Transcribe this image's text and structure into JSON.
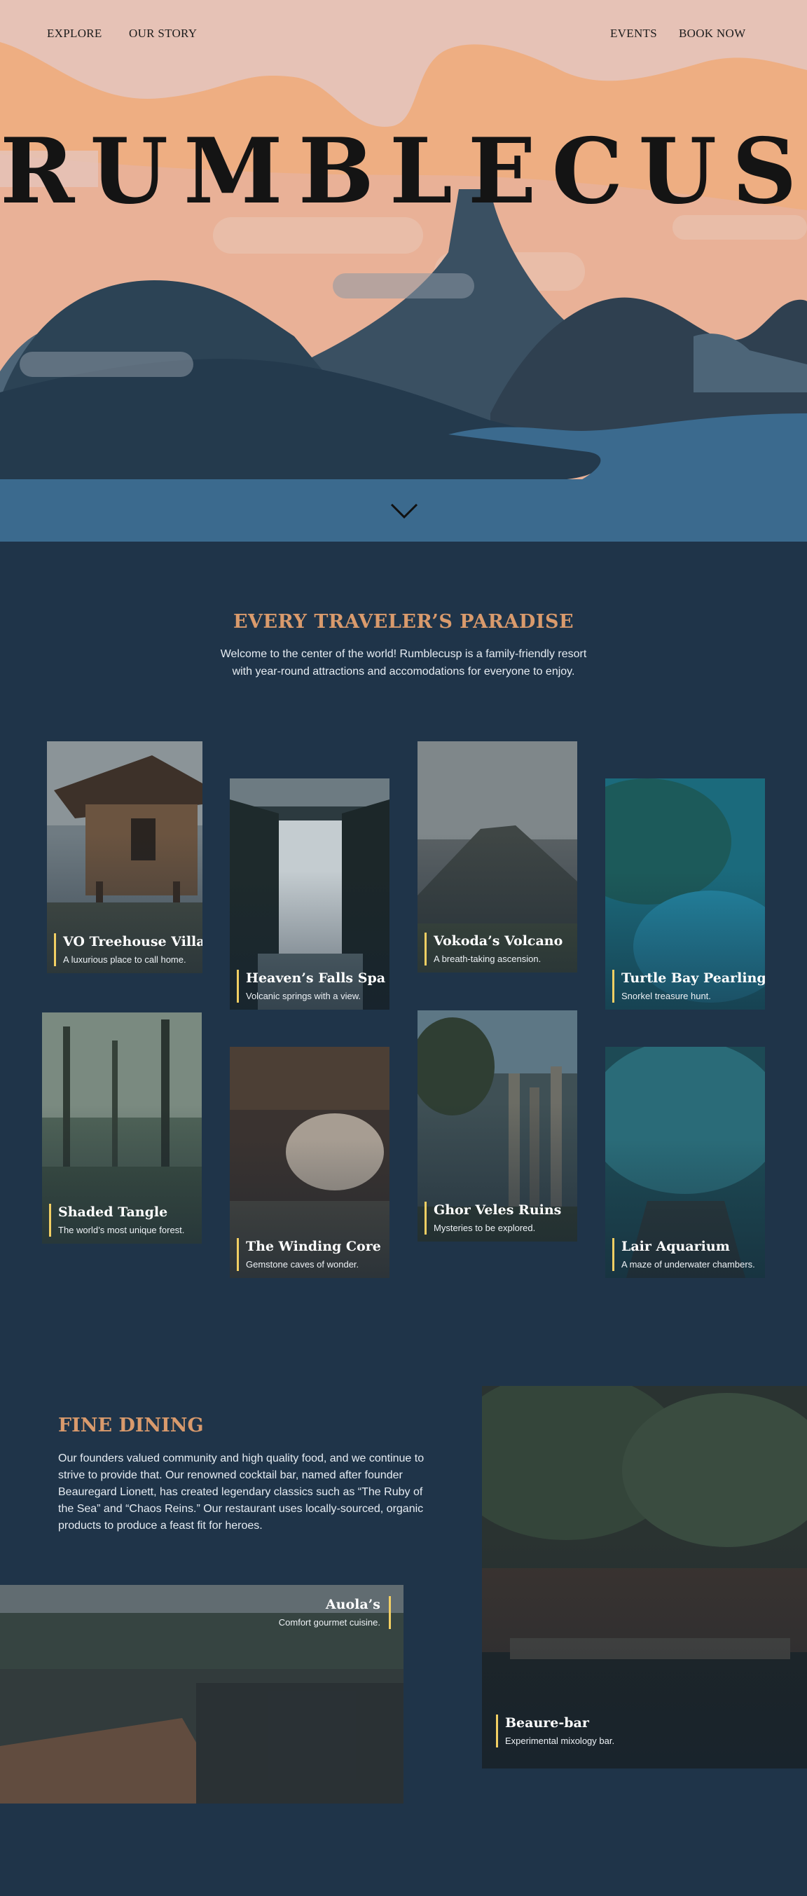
{
  "nav": {
    "explore": "EXPLORE",
    "our_story": "OUR STORY",
    "events": "EVENTS",
    "book_now": "BOOK NOW"
  },
  "hero": {
    "title": "RUMBLECUSP",
    "scroll_icon": "chevron-down-icon"
  },
  "paradise": {
    "title": "EVERY TRAVELER’S PARADISE",
    "intro_line1": "Welcome to the center of the world! Rumblecusp is a family-friendly resort",
    "intro_line2": "with year-round attractions and accomodations for everyone to enjoy."
  },
  "attractions": [
    {
      "name": "VO Treehouse Villas",
      "desc": "A luxurious place to call home."
    },
    {
      "name": "Heaven’s Falls Spa",
      "desc": "Volcanic springs with a view."
    },
    {
      "name": "Vokoda’s Volcano",
      "desc": "A breath-taking ascension."
    },
    {
      "name": "Turtle Bay Pearling",
      "desc": "Snorkel treasure hunt."
    },
    {
      "name": "Shaded Tangle",
      "desc": "The world’s most unique forest."
    },
    {
      "name": "The Winding Core",
      "desc": "Gemstone caves of wonder."
    },
    {
      "name": "Ghor Veles Ruins",
      "desc": "Mysteries to be explored."
    },
    {
      "name": "Lair Aquarium",
      "desc": "A maze of underwater chambers."
    }
  ],
  "dining": {
    "title": "FINE DINING",
    "text": "Our founders valued community and high quality food, and we continue to strive to provide that. Our renowned cocktail bar, named after founder Beauregard Lionett, has created legendary classics such as “The Ruby of the Sea” and “Chaos Reins.” Our restaurant uses locally-sourced, organic products to produce a feast fit for heroes.",
    "restaurant": {
      "name": "Auola’s",
      "desc": "Comfort gourmet cuisine."
    },
    "bar": {
      "name": "Beaure-bar",
      "desc": "Experimental mixology bar."
    }
  },
  "colors": {
    "accent": "#d99a6c",
    "caption_bar": "#f2cf63",
    "background": "#1f3449",
    "sky": "#e6c2b6",
    "sunset": "#eeae82",
    "water": "#3b6a8e"
  }
}
